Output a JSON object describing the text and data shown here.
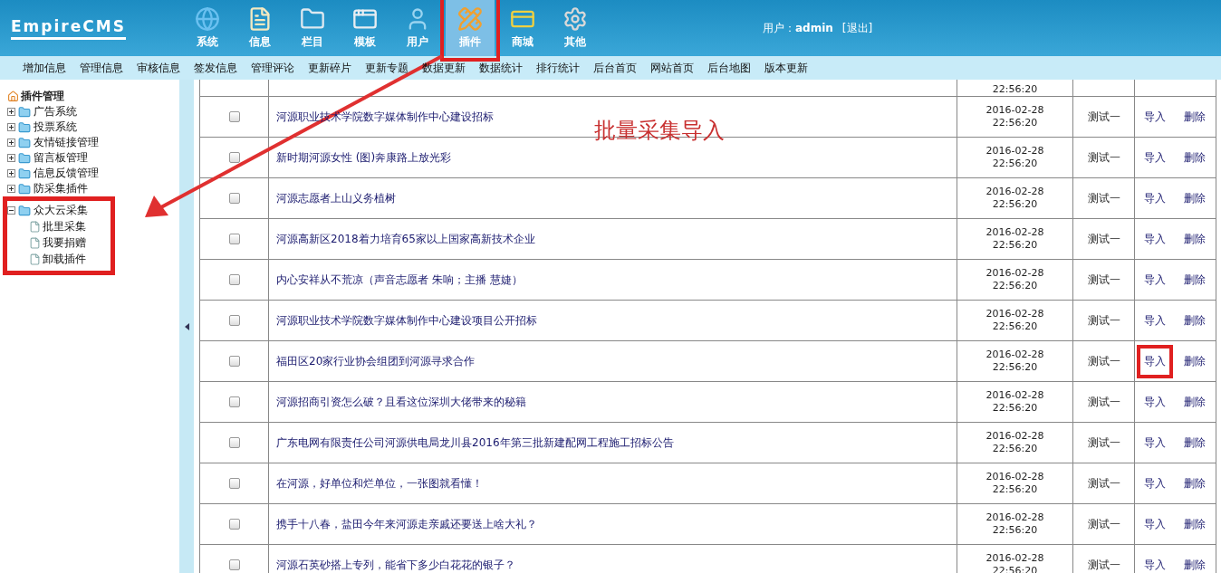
{
  "header": {
    "logo": "EmpireCMS",
    "nav": [
      {
        "label": "系统",
        "selected": false,
        "highlighted": false
      },
      {
        "label": "信息",
        "selected": false,
        "highlighted": false
      },
      {
        "label": "栏目",
        "selected": false,
        "highlighted": false
      },
      {
        "label": "模板",
        "selected": false,
        "highlighted": false
      },
      {
        "label": "用户",
        "selected": false,
        "highlighted": false
      },
      {
        "label": "插件",
        "selected": true,
        "highlighted": true
      },
      {
        "label": "商城",
        "selected": false,
        "highlighted": false
      },
      {
        "label": "其他",
        "selected": false,
        "highlighted": false
      }
    ],
    "user_label": "用户：",
    "user_name": "admin",
    "logout": "[退出]"
  },
  "subnav": [
    "增加信息",
    "管理信息",
    "审核信息",
    "签发信息",
    "管理评论",
    "更新碎片",
    "更新专题",
    "数据更新",
    "数据统计",
    "排行统计",
    "后台首页",
    "网站首页",
    "后台地图",
    "版本更新"
  ],
  "sidebar": {
    "title": "插件管理",
    "tree": [
      {
        "label": "广告系统",
        "expanded": false,
        "highlighted": false
      },
      {
        "label": "投票系统",
        "expanded": false,
        "highlighted": false
      },
      {
        "label": "友情链接管理",
        "expanded": false,
        "highlighted": false
      },
      {
        "label": "留言板管理",
        "expanded": false,
        "highlighted": false
      },
      {
        "label": "信息反馈管理",
        "expanded": false,
        "highlighted": false
      },
      {
        "label": "防采集插件",
        "expanded": false,
        "highlighted": false
      },
      {
        "label": "众大云采集",
        "expanded": true,
        "highlighted": true,
        "children": [
          {
            "label": "批里采集"
          },
          {
            "label": "我要捐赠"
          },
          {
            "label": "卸载插件"
          }
        ]
      }
    ]
  },
  "annotation": "批量采集导入",
  "table": {
    "rows": [
      {
        "kind": "partial",
        "time": "22:56:20"
      },
      {
        "kind": "full",
        "title": "河源职业技术学院数字媒体制作中心建设招标",
        "date": "2016-02-28",
        "time": "22:56:20",
        "user": "测试一",
        "import": "导入",
        "delete": "删除",
        "checked": false,
        "highlighted": false
      },
      {
        "kind": "full",
        "title": "新时期河源女性 (图)奔康路上放光彩",
        "date": "2016-02-28",
        "time": "22:56:20",
        "user": "测试一",
        "import": "导入",
        "delete": "删除",
        "checked": false,
        "highlighted": false
      },
      {
        "kind": "full",
        "title": "河源志愿者上山义务植树",
        "date": "2016-02-28",
        "time": "22:56:20",
        "user": "测试一",
        "import": "导入",
        "delete": "删除",
        "checked": false,
        "highlighted": false
      },
      {
        "kind": "full",
        "title": "河源高新区2018着力培育65家以上国家高新技术企业",
        "date": "2016-02-28",
        "time": "22:56:20",
        "user": "测试一",
        "import": "导入",
        "delete": "删除",
        "checked": false,
        "highlighted": false
      },
      {
        "kind": "full",
        "title": "内心安祥从不荒凉（声音志愿者 朱响；主播 慧婕）",
        "date": "2016-02-28",
        "time": "22:56:20",
        "user": "测试一",
        "import": "导入",
        "delete": "删除",
        "checked": false,
        "highlighted": false
      },
      {
        "kind": "full",
        "title": "河源职业技术学院数字媒体制作中心建设项目公开招标",
        "date": "2016-02-28",
        "time": "22:56:20",
        "user": "测试一",
        "import": "导入",
        "delete": "删除",
        "checked": false,
        "highlighted": false
      },
      {
        "kind": "full",
        "title": "福田区20家行业协会组团到河源寻求合作",
        "date": "2016-02-28",
        "time": "22:56:20",
        "user": "测试一",
        "import": "导入",
        "delete": "删除",
        "checked": false,
        "highlighted": true
      },
      {
        "kind": "full",
        "title": "河源招商引资怎么破？且看这位深圳大佬带来的秘籍",
        "date": "2016-02-28",
        "time": "22:56:20",
        "user": "测试一",
        "import": "导入",
        "delete": "删除",
        "checked": false,
        "highlighted": false
      },
      {
        "kind": "full",
        "title": "广东电网有限责任公司河源供电局龙川县2016年第三批新建配网工程施工招标公告",
        "date": "2016-02-28",
        "time": "22:56:20",
        "user": "测试一",
        "import": "导入",
        "delete": "删除",
        "checked": false,
        "highlighted": false
      },
      {
        "kind": "full",
        "title": "在河源，好单位和烂单位，一张图就看懂！",
        "date": "2016-02-28",
        "time": "22:56:20",
        "user": "测试一",
        "import": "导入",
        "delete": "删除",
        "checked": false,
        "highlighted": false
      },
      {
        "kind": "full",
        "title": "携手十八春，盐田今年来河源走亲戚还要送上啥大礼？",
        "date": "2016-02-28",
        "time": "22:56:20",
        "user": "测试一",
        "import": "导入",
        "delete": "删除",
        "checked": false,
        "highlighted": false
      },
      {
        "kind": "full",
        "title": "河源石英砂搭上专列，能省下多少白花花的银子？",
        "date": "2016-02-28",
        "time": "22:56:20",
        "user": "测试一",
        "import": "导入",
        "delete": "删除",
        "checked": false,
        "highlighted": false
      }
    ]
  }
}
